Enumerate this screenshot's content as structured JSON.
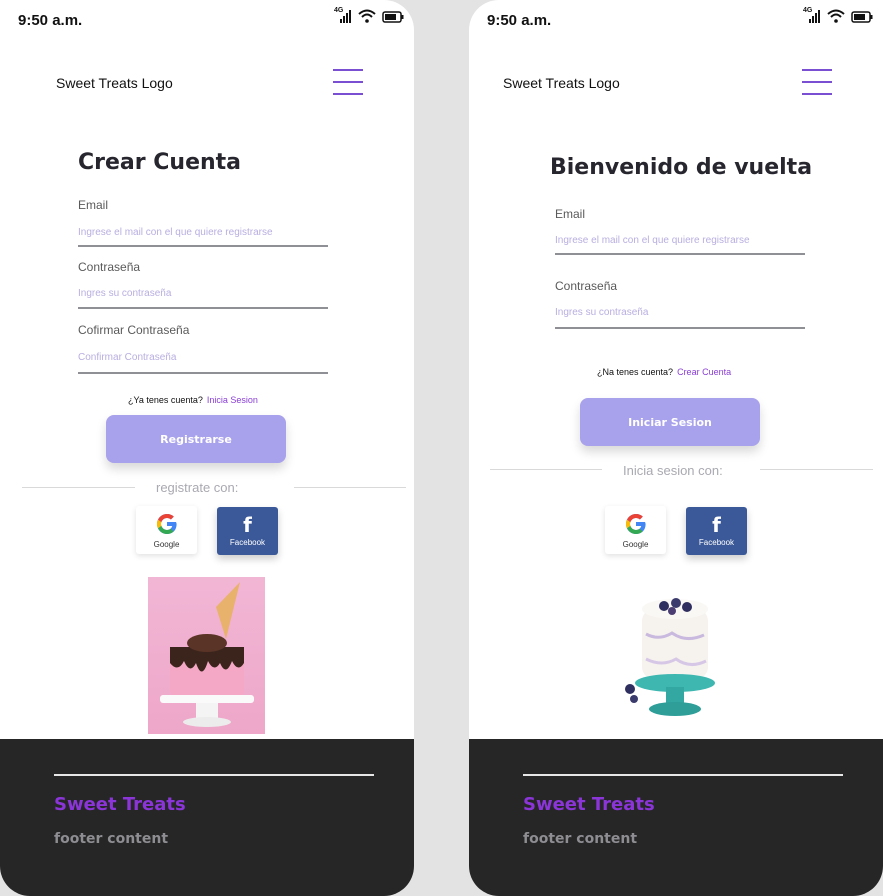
{
  "status_bar": {
    "time": "9:50 a.m.",
    "network": "4G"
  },
  "colors": {
    "accent": "#8a3ed6",
    "button": "#a8a1ec",
    "footer_bg": "#262626",
    "facebook": "#3b5998"
  },
  "header": {
    "logo": "Sweet Treats Logo",
    "menu_icon": "hamburger-menu-icon"
  },
  "register": {
    "title": "Crear Cuenta",
    "email_label": "Email",
    "email_placeholder": "Ingrese el mail con el que quiere registrarse",
    "password_label": "Contraseña",
    "password_placeholder": "Ingres su contraseña",
    "confirm_label": "Cofirmar  Contraseña",
    "confirm_placeholder": "Confirmar Contraseña",
    "have_account": "¿Ya tenes cuenta?",
    "login_link": "Inicia Sesion",
    "submit_label": "Registrarse",
    "social_caption": "registrate con:",
    "google_label": "Google",
    "facebook_label": "Facebook"
  },
  "login": {
    "title": "Bienvenido de vuelta",
    "email_label": "Email",
    "email_placeholder": "Ingrese el mail con el que quiere registrarse",
    "password_label": "Contraseña",
    "password_placeholder": "Ingres su contraseña",
    "no_account": "¿Na tenes cuenta?",
    "register_link": "Crear Cuenta",
    "submit_label": "Iniciar Sesion",
    "social_caption": "Inicia sesion  con:",
    "google_label": "Google",
    "facebook_label": "Facebook"
  },
  "footer": {
    "brand": "Sweet Treats",
    "content": "footer content"
  }
}
